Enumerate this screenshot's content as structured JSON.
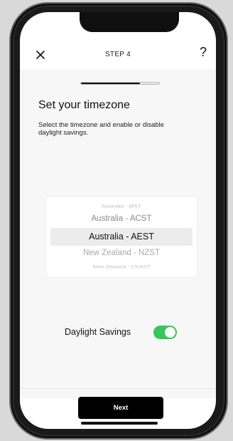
{
  "header": {
    "step_label": "STEP 4",
    "help_label": "?",
    "close_icon": "close-icon"
  },
  "progress": {
    "fraction": 0.75
  },
  "main": {
    "title": "Set your timezone",
    "subtitle": "Select the timezone and enable or disable daylight savings."
  },
  "timezone_picker": {
    "options": [
      "Australia - WST",
      "Australia - ACST",
      "Australia - AEST",
      "New Zealand - NZST",
      "New Zealand - CHAST"
    ],
    "selected": "Australia - AEST"
  },
  "daylight_savings": {
    "label": "Daylight Savings",
    "enabled": true
  },
  "footer": {
    "next_label": "Next"
  },
  "colors": {
    "accent": "#35c759",
    "button": "#000000",
    "screen_background": "#f7f7f7"
  }
}
